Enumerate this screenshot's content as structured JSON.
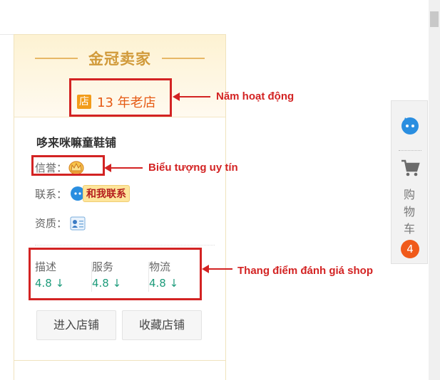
{
  "card": {
    "crown_title": "金冠卖家",
    "years_badge": "店",
    "years_text": "13 年老店",
    "shop_name": "哆来咪嘛童鞋铺",
    "reputation_label": "信誉：",
    "contact_label": "联系：",
    "contact_button": "和我联系",
    "qualification_label": "资质：",
    "scores": [
      {
        "name": "描述",
        "value": "4.8",
        "trend": "↓"
      },
      {
        "name": "服务",
        "value": "4.8",
        "trend": "↓"
      },
      {
        "name": "物流",
        "value": "4.8",
        "trend": "↓"
      }
    ],
    "enter_store": "进入店铺",
    "favorite_store": "收藏店铺"
  },
  "annotations": {
    "years": "Năm hoạt động",
    "reputation": "Biểu tượng uy tín",
    "scores": "Thang điểm đánh giá shop"
  },
  "sidebar": {
    "chat_icon": "wangwang-chat-icon",
    "cart_icon": "shopping-cart-icon",
    "cart_label": "购物车",
    "cart_count": "4"
  },
  "colors": {
    "accent_red": "#d32323",
    "score_green": "#1f9c7c",
    "crown_gold": "#d19a3a",
    "badge_orange": "#f05a1a"
  }
}
